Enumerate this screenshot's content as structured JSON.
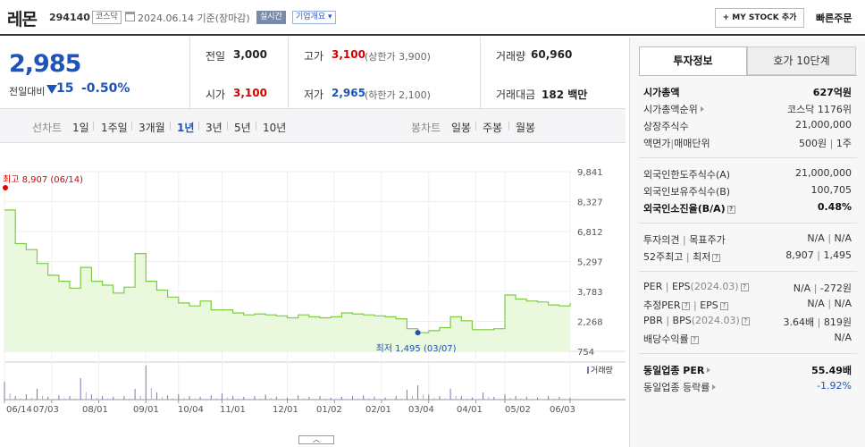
{
  "header": {
    "name": "레몬",
    "code": "294140",
    "market": "코스닥",
    "date": "2024.06.14",
    "basis": "기준(장마감)",
    "realtime": "실시간",
    "company_info": "기업개요",
    "mystock_btn": "+ MY STOCK 추가",
    "quick_order": "빠른주문"
  },
  "price": {
    "current": "2,985",
    "change_label": "전일대비",
    "change": "15",
    "change_pct": "-0.50%",
    "prev_close_label": "전일",
    "prev_close": "3,000",
    "open_label": "시가",
    "open": "3,100",
    "high_label": "고가",
    "high": "3,100",
    "upper_limit": "(상한가 3,900)",
    "low_label": "저가",
    "low": "2,965",
    "lower_limit": "(하한가 2,100)",
    "volume_label": "거래량",
    "volume": "60,960",
    "amount_label": "거래대금",
    "amount": "182",
    "amount_unit": "백만"
  },
  "period_tabs": {
    "line_label": "선차트",
    "items": [
      "1일",
      "1주일",
      "3개월",
      "1년",
      "3년",
      "5년",
      "10년"
    ],
    "active": "1년",
    "candle_label": "봉차트",
    "candle_items": [
      "일봉",
      "주봉",
      "월봉"
    ]
  },
  "chart_data": {
    "type": "area",
    "y_ticks": [
      "9,841",
      "8,327",
      "6,812",
      "5,297",
      "3,783",
      "2,268",
      "754"
    ],
    "ylim": [
      754,
      9841
    ],
    "x_ticks": [
      "06/14",
      "07/03",
      "08/01",
      "09/01",
      "10/04",
      "11/01",
      "12/01",
      "01/02",
      "02/01",
      "03/04",
      "04/01",
      "05/02",
      "06/03"
    ],
    "high_label": "최고 8,907 (06/14)",
    "low_label": "최저 1,495 (03/07)",
    "volume_label": "거래량",
    "x": [
      "06/14",
      "06/21",
      "06/28",
      "07/05",
      "07/12",
      "07/19",
      "07/26",
      "08/02",
      "08/09",
      "08/16",
      "08/23",
      "08/30",
      "09/06",
      "09/13",
      "09/20",
      "09/27",
      "10/04",
      "10/11",
      "10/18",
      "10/25",
      "11/01",
      "11/08",
      "11/15",
      "11/22",
      "11/29",
      "12/06",
      "12/13",
      "12/20",
      "12/27",
      "01/03",
      "01/10",
      "01/17",
      "01/24",
      "01/31",
      "02/07",
      "02/14",
      "02/21",
      "02/28",
      "03/07",
      "03/14",
      "03/21",
      "03/28",
      "04/04",
      "04/11",
      "04/18",
      "04/25",
      "05/02",
      "05/09",
      "05/16",
      "05/23",
      "05/30",
      "06/06",
      "06/14"
    ],
    "series": [
      {
        "values": [
          7900,
          6200,
          5900,
          5200,
          4600,
          4300,
          3950,
          5000,
          4300,
          4100,
          3700,
          4000,
          5700,
          4300,
          3850,
          3500,
          3200,
          3050,
          3300,
          2850,
          2850,
          2700,
          2600,
          2650,
          2600,
          2550,
          2450,
          2600,
          2500,
          2450,
          2500,
          2700,
          2650,
          2600,
          2550,
          2500,
          2400,
          1900,
          1700,
          1800,
          1950,
          2500,
          2300,
          1850,
          1850,
          1900,
          3600,
          3400,
          3300,
          3250,
          3100,
          3050,
          3200
        ]
      },
      {
        "name": "거래량",
        "values": [
          50,
          10,
          15,
          30,
          8,
          12,
          10,
          60,
          15,
          10,
          8,
          10,
          30,
          95,
          20,
          12,
          15,
          10,
          8,
          12,
          18,
          10,
          8,
          10,
          14,
          8,
          6,
          12,
          8,
          10,
          6,
          8,
          10,
          12,
          8,
          6,
          10,
          28,
          40,
          14,
          10,
          30,
          10,
          6,
          20,
          8,
          15,
          10,
          8,
          6,
          10,
          8,
          6
        ]
      }
    ]
  },
  "side": {
    "tab_invest": "투자정보",
    "tab_quote": "호가 10단계",
    "rows": {
      "mcap_label": "시가총액",
      "mcap": "627억원",
      "mcap_rank_label": "시가총액순위",
      "mcap_rank": "코스닥 1176위",
      "shares_label": "상장주식수",
      "shares": "21,000,000",
      "par_label": "액면가",
      "par_sep": "|",
      "lot_label": "매매단위",
      "par": "500원",
      "lot": "1주",
      "foreign_limit_label": "외국인한도주식수(A)",
      "foreign_limit": "21,000,000",
      "foreign_hold_label": "외국인보유주식수(B)",
      "foreign_hold": "100,705",
      "foreign_ratio_label": "외국인소진율(B/A)",
      "foreign_ratio": "0.48%",
      "opinion_label": "투자의견",
      "target_label": "목표주가",
      "opinion": "N/A",
      "target": "N/A",
      "w52_hi_label": "52주최고",
      "w52_lo_label": "최저",
      "w52_hi": "8,907",
      "w52_lo": "1,495",
      "per_label": "PER",
      "eps_label": "EPS",
      "eps_period": "(2024.03)",
      "per": "N/A",
      "eps": "-272원",
      "est_per_label": "추정PER",
      "est_eps_label": "EPS",
      "est_per": "N/A",
      "est_eps": "N/A",
      "pbr_label": "PBR",
      "bps_label": "BPS",
      "bps_period": "(2024.03)",
      "pbr": "3.64배",
      "bps": "819원",
      "dividend_label": "배당수익률",
      "dividend": "N/A",
      "sector_per_label": "동일업종 PER",
      "sector_per": "55.49배",
      "sector_chg_label": "동일업종 등락률",
      "sector_chg": "-1.92%"
    }
  }
}
